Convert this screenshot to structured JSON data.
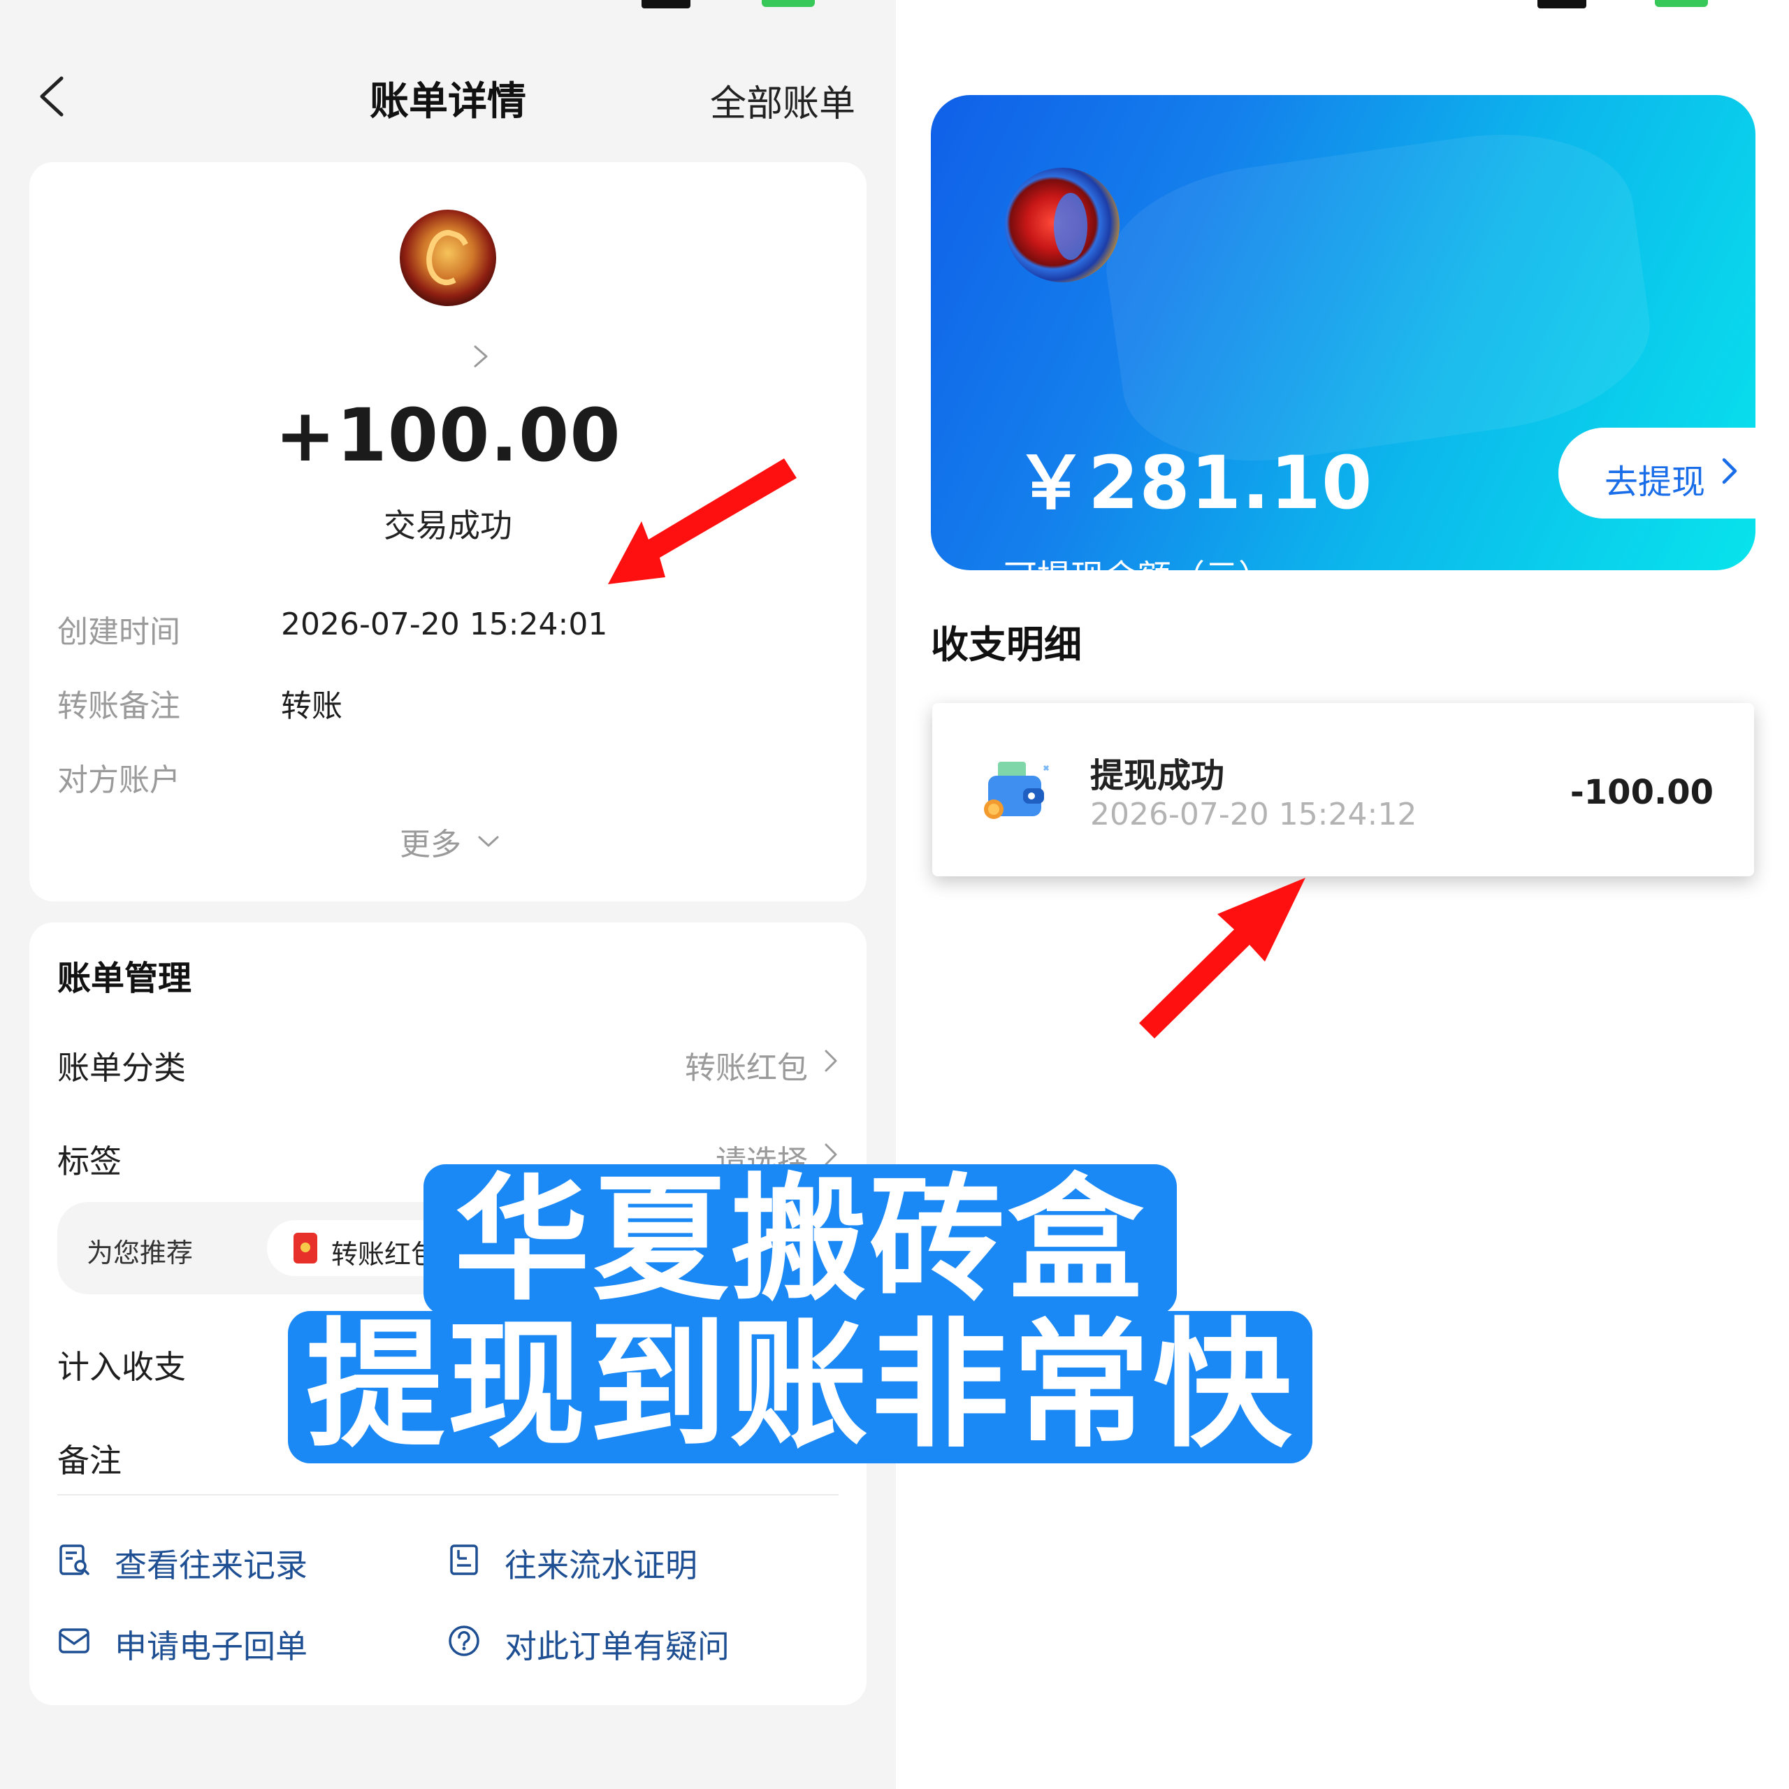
{
  "left_screen": {
    "header": {
      "title": "账单详情",
      "right_action": "全部账单"
    },
    "summary": {
      "amount": "+100.00",
      "status": "交易成功"
    },
    "details": [
      {
        "label": "创建时间",
        "value": "2026-07-20 15:24:01"
      },
      {
        "label": "转账备注",
        "value": "转账"
      },
      {
        "label": "对方账户",
        "value": ""
      }
    ],
    "more_label": "更多",
    "management": {
      "title": "账单管理",
      "category": {
        "label": "账单分类",
        "value": "转账红包"
      },
      "tags": {
        "label": "标签",
        "value": "请选择"
      },
      "recommend": {
        "label": "为您推荐",
        "chip": "转账红包"
      },
      "count_in": {
        "label": "计入收支"
      },
      "remark": {
        "label": "备注"
      }
    },
    "links": [
      {
        "label": "查看往来记录",
        "icon": "record-search-icon"
      },
      {
        "label": "往来流水证明",
        "icon": "statement-icon"
      },
      {
        "label": "申请电子回单",
        "icon": "envelope-icon"
      },
      {
        "label": "对此订单有疑问",
        "icon": "question-circle-icon"
      }
    ]
  },
  "right_screen": {
    "balance_card": {
      "amount": "￥281.10",
      "label": "可提现余额（元）",
      "withdraw_button": "去提现",
      "gradient_start": "#1060e8",
      "gradient_end": "#08e4ec"
    },
    "section_title": "收支明细",
    "transactions": [
      {
        "title": "提现成功",
        "time": "2026-07-20 15:24:12",
        "amount": "-100.00",
        "icon": "wallet-icon"
      }
    ]
  },
  "overlay": {
    "line1": "华夏搬砖盒",
    "line2": "提现到账非常快",
    "color": "#1a88f5"
  },
  "colors": {
    "link_blue": "#1f4f93",
    "accent_blue": "#1a6de8",
    "arrow_red": "#ff1010"
  }
}
